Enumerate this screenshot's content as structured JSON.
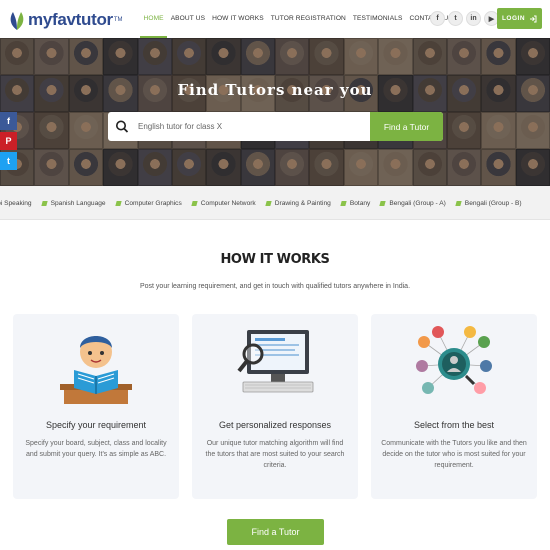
{
  "header": {
    "logo_text": "myfavtutor",
    "logo_tm": "TM",
    "nav": [
      {
        "label": "HOME",
        "active": true
      },
      {
        "label": "ABOUT US",
        "active": false
      },
      {
        "label": "HOW IT WORKS",
        "active": false
      },
      {
        "label": "TUTOR REGISTRATION",
        "active": false
      },
      {
        "label": "TESTIMONIALS",
        "active": false
      },
      {
        "label": "CONTACT US",
        "active": false
      }
    ],
    "social": [
      {
        "name": "facebook-icon",
        "glyph": "f"
      },
      {
        "name": "twitter-icon",
        "glyph": "t"
      },
      {
        "name": "linkedin-icon",
        "glyph": "in"
      },
      {
        "name": "youtube-icon",
        "glyph": "▶"
      }
    ],
    "login_label": "LOGIN",
    "login_icon": "login-arrow-icon"
  },
  "hero": {
    "title": "Find Tutors near you",
    "search_placeholder": "English tutor for class X",
    "search_button": "Find a Tutor"
  },
  "share": [
    {
      "name": "facebook-share-icon",
      "glyph": "f",
      "color": "#3b5998"
    },
    {
      "name": "pinterest-share-icon",
      "glyph": "P",
      "color": "#cb2027"
    },
    {
      "name": "twitter-share-icon",
      "glyph": "t",
      "color": "#1da1f2"
    }
  ],
  "ticker": [
    "jabi Speaking",
    "Spanish Language",
    "Computer Graphics",
    "Computer Network",
    "Drawing & Painting",
    "Botany",
    "Bengali (Group - A)",
    "Bengali (Group - B)"
  ],
  "how_it_works": {
    "title": "HOW IT WORKS",
    "subtitle": "Post your learning requirement, and get in touch with qualified tutors anywhere in India.",
    "cards": [
      {
        "title": "Specify your requirement",
        "desc": "Specify your board, subject, class and locality and submit your query. It's as simple as ABC."
      },
      {
        "title": "Get personalized responses",
        "desc": "Our unique tutor matching algorithm will find the tutors that are most suited to your search criteria."
      },
      {
        "title": "Select from the best",
        "desc": "Communicate with the Tutors you like and then decide on the tutor who is most suited for your requirement."
      }
    ],
    "cta": "Find a Tutor"
  },
  "colors": {
    "accent": "#7cb342",
    "brand": "#2f4b8f"
  }
}
